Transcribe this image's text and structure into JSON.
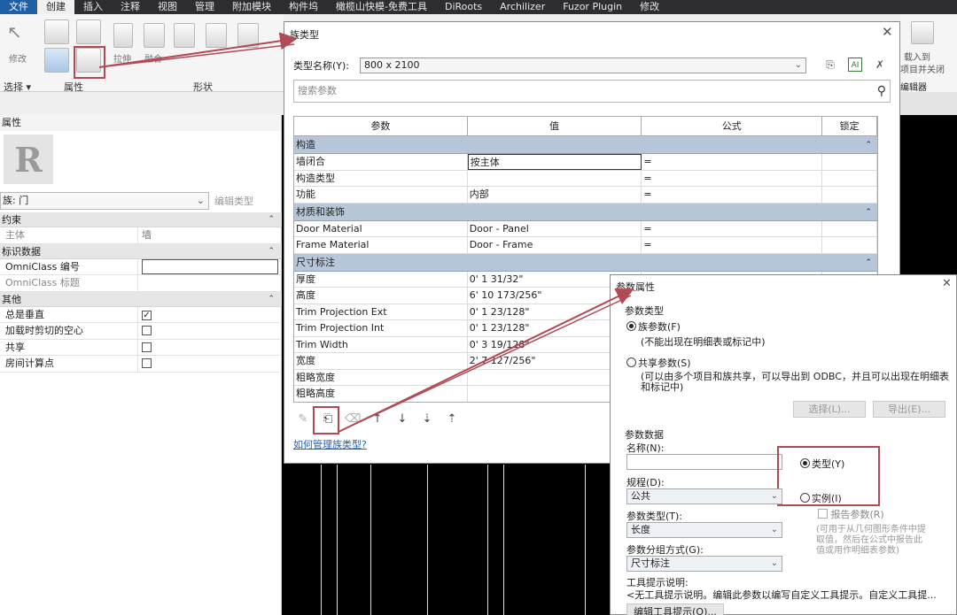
{
  "ribbon": {
    "tabs": [
      "文件",
      "创建",
      "插入",
      "注释",
      "视图",
      "管理",
      "附加模块",
      "构件坞",
      "橄榄山快模-免费工具",
      "DiRoots",
      "Archilizer",
      "Fuzor Plugin",
      "修改"
    ],
    "tools": {
      "modify": "修改",
      "extrude": "拉伸",
      "blend": "融合",
      "select": "选择 ▾",
      "properties_group": "属性",
      "shapes_group": "形状"
    },
    "right": {
      "load_line1": "载入到",
      "load_line2": "项目并关闭",
      "editor": "编辑器"
    }
  },
  "properties": {
    "title": "属性",
    "logo": "R",
    "family": "族: 门",
    "edit_type": "编辑类型",
    "sections": [
      {
        "name": "约束",
        "rows": [
          {
            "k": "主体",
            "v": "墙",
            "grey": true
          }
        ]
      },
      {
        "name": "标识数据",
        "rows": [
          {
            "k": "OmniClass 编号",
            "v": "",
            "input": true
          },
          {
            "k": "OmniClass 标题",
            "v": "",
            "grey": true
          }
        ]
      },
      {
        "name": "其他",
        "rows": [
          {
            "k": "总是垂直",
            "check": true
          },
          {
            "k": "加载时剪切的空心",
            "check": false
          },
          {
            "k": "共享",
            "check": false
          },
          {
            "k": "房间计算点",
            "check": false
          }
        ]
      }
    ]
  },
  "family_types": {
    "title": "族类型",
    "type_name_label": "类型名称(Y):",
    "type_name": "800 x 2100",
    "search_placeholder": "搜索参数",
    "headers": [
      "参数",
      "值",
      "公式",
      "锁定"
    ],
    "sections": [
      {
        "name": "构造",
        "rows": [
          [
            "墙闭合",
            "按主体",
            "="
          ],
          [
            "构造类型",
            "",
            "="
          ],
          [
            "功能",
            "内部",
            "="
          ]
        ]
      },
      {
        "name": "材质和装饰",
        "rows": [
          [
            "Door Material",
            "Door - Panel",
            "="
          ],
          [
            "Frame Material",
            "Door - Frame",
            "="
          ]
        ]
      },
      {
        "name": "尺寸标注",
        "rows": [
          [
            "厚度",
            "0'  1 31/32\"",
            ""
          ],
          [
            "高度",
            "6'  10 173/256\"",
            ""
          ],
          [
            "Trim Projection Ext",
            "0'  1 23/128\"",
            ""
          ],
          [
            "Trim Projection Int",
            "0'  1 23/128\"",
            ""
          ],
          [
            "Trim Width",
            "0'  3 19/128\"",
            ""
          ],
          [
            "宽度",
            "2'  7 127/256\"",
            ""
          ],
          [
            "粗略宽度",
            "",
            ""
          ],
          [
            "粗略高度",
            "",
            ""
          ]
        ]
      }
    ],
    "help_link": "如何管理族类型?"
  },
  "param_props": {
    "title": "参数属性",
    "param_type": "参数类型",
    "family_param": "族参数(F)",
    "family_param_note": "(不能出现在明细表或标记中)",
    "shared_param": "共享参数(S)",
    "shared_param_note1": "(可以由多个项目和族共享，可以导出到 ODBC，并且可以出现在明细表",
    "shared_param_note2": "和标记中)",
    "select_btn": "选择(L)...",
    "export_btn": "导出(E)...",
    "param_data": "参数数据",
    "name_label": "名称(N):",
    "type_radio": "类型(Y)",
    "instance_radio": "实例(I)",
    "discipline_label": "规程(D):",
    "discipline": "公共",
    "report_param": "报告参数(R)",
    "report_note1": "(可用于从几何图形条件中提",
    "report_note2": "取值，然后在公式中报告此",
    "report_note3": "值或用作明细表参数)",
    "ptype_label": "参数类型(T):",
    "ptype": "长度",
    "group_label": "参数分组方式(G):",
    "group": "尺寸标注",
    "tooltip_label": "工具提示说明:",
    "tooltip_text": "<无工具提示说明。编辑此参数以编写自定义工具提示。自定义工具提...",
    "edit_tooltip_btn": "编辑工具提示(O)..."
  },
  "colors": {
    "highlight": "#b04a55",
    "section_blue": "#b7c7d9",
    "file_tab": "#1e5fa8"
  }
}
